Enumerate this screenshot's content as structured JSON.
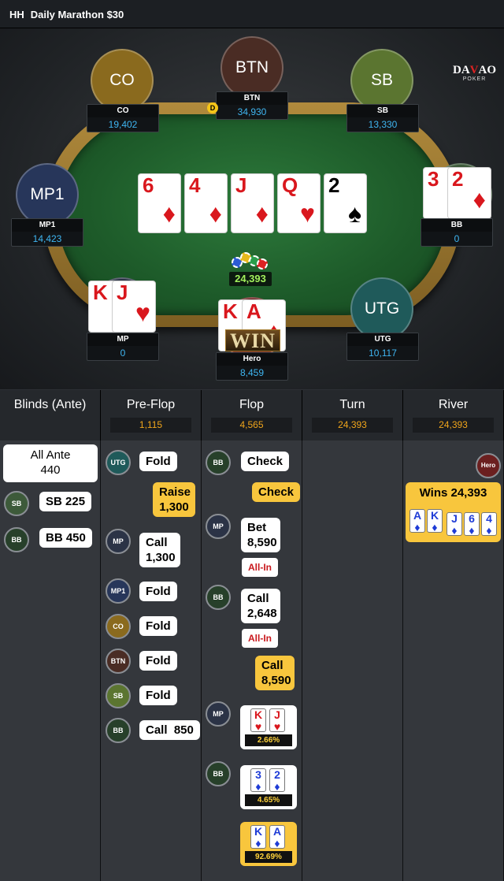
{
  "header": {
    "prefix": "HH",
    "title": "Daily Marathon $30"
  },
  "logo": {
    "line1_a": "DA",
    "line1_b": "V",
    "line1_c": "AO",
    "line2": "POKER"
  },
  "table": {
    "seats": [
      {
        "id": "co",
        "label": "CO",
        "name": "CO",
        "stack": "19,402",
        "color": "#8a6a1e"
      },
      {
        "id": "btn",
        "label": "BTN",
        "name": "BTN",
        "stack": "34,930",
        "color": "#4a2c24"
      },
      {
        "id": "sb",
        "label": "SB",
        "name": "SB",
        "stack": "13,330",
        "color": "#5b7530"
      },
      {
        "id": "mp1",
        "label": "MP1",
        "name": "MP1",
        "stack": "14,423",
        "color": "#27365a"
      },
      {
        "id": "bb",
        "label": "",
        "name": "BB",
        "stack": "0",
        "color": "#3d5a3a"
      },
      {
        "id": "mp",
        "label": "",
        "name": "MP",
        "stack": "0",
        "color": "#2b3346"
      },
      {
        "id": "hero",
        "label": "",
        "name": "Hero",
        "stack": "8,459",
        "color": "#6b1f1f"
      },
      {
        "id": "utg",
        "label": "UTG",
        "name": "UTG",
        "stack": "10,117",
        "color": "#1f5a5a"
      }
    ],
    "dealer": "D",
    "pot": "24,393",
    "win_badge": "WIN",
    "board": [
      {
        "rank": "6",
        "suit": "♦",
        "color": "red"
      },
      {
        "rank": "4",
        "suit": "♦",
        "color": "red"
      },
      {
        "rank": "J",
        "suit": "♦",
        "color": "red"
      },
      {
        "rank": "Q",
        "suit": "♥",
        "color": "red"
      },
      {
        "rank": "2",
        "suit": "♠",
        "color": "black"
      }
    ],
    "hole_cards": {
      "bb": [
        {
          "rank": "3",
          "suit": "♦"
        },
        {
          "rank": "2",
          "suit": "♦"
        }
      ],
      "mp": [
        {
          "rank": "K",
          "suit": "♥"
        },
        {
          "rank": "J",
          "suit": "♥"
        }
      ],
      "hero": [
        {
          "rank": "K",
          "suit": "♦"
        },
        {
          "rank": "A",
          "suit": "♦"
        }
      ]
    }
  },
  "streets": [
    {
      "name": "Blinds (Ante)",
      "pot": ""
    },
    {
      "name": "Pre-Flop",
      "pot": "1,115"
    },
    {
      "name": "Flop",
      "pot": "4,565"
    },
    {
      "name": "Turn",
      "pot": "24,393"
    },
    {
      "name": "River",
      "pot": "24,393"
    }
  ],
  "blinds": {
    "ante_label": "All Ante",
    "ante_value": "440",
    "sb_icon": "SB",
    "sb_text": "SB 225",
    "bb_icon": "BB",
    "bb_text": "BB 450"
  },
  "preflop": [
    {
      "icon": "UTG",
      "text": "Fold"
    },
    {
      "icon": "",
      "text": "Raise 1,300"
    },
    {
      "icon": "MP",
      "text": "Call 1,300"
    },
    {
      "icon": "MP1",
      "text": "Fold"
    },
    {
      "icon": "CO",
      "text": "Fold"
    },
    {
      "icon": "BTN",
      "text": "Fold"
    },
    {
      "icon": "SB",
      "text": "Fold"
    },
    {
      "icon": "BB",
      "text": "Call  850"
    }
  ],
  "flop": {
    "a1_icon": "BB",
    "a1_text": "Check",
    "a2_text": "Check",
    "a3_icon": "MP",
    "a3_l1": "Bet",
    "a3_l2": "8,590",
    "a3_allin": "All-In",
    "a4_icon": "BB",
    "a4_l1": "Call",
    "a4_l2": "2,648",
    "a4_allin": "All-In",
    "a5_l1": "Call",
    "a5_l2": "8,590",
    "sd_mp_icon": "MP",
    "sd_mp_pct": "2.66%",
    "sd_bb_icon": "BB",
    "sd_bb_pct": "4.65%",
    "sd_hero_pct": "92.69%"
  },
  "river": {
    "hero_icon": "Hero",
    "wins": "Wins 24,393",
    "cards": [
      {
        "rank": "A",
        "suit": "♦"
      },
      {
        "rank": "K",
        "suit": "♦"
      },
      {
        "rank": "J",
        "suit": "♦"
      },
      {
        "rank": "6",
        "suit": "♦"
      },
      {
        "rank": "4",
        "suit": "♦"
      }
    ]
  }
}
